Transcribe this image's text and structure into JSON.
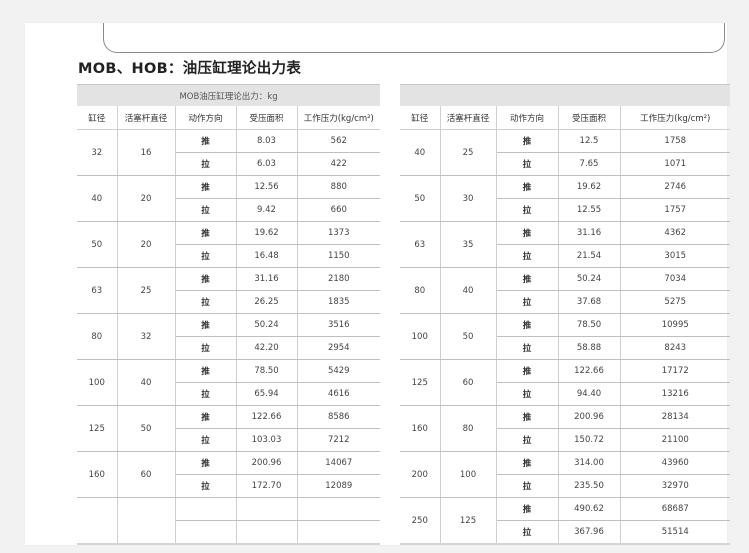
{
  "title": "MOB、HOB：油压缸理论出力表",
  "tables": [
    {
      "caption": "MOB油压缸理论出力：kg",
      "headers": [
        "缸径",
        "活塞杆直径",
        "动作方向",
        "受压面积",
        "工作压力(kg/cm²)"
      ],
      "groups": [
        {
          "bore": "32",
          "rod": "16",
          "rows": [
            [
              "推",
              "8.03",
              "562"
            ],
            [
              "拉",
              "6.03",
              "422"
            ]
          ]
        },
        {
          "bore": "40",
          "rod": "20",
          "rows": [
            [
              "推",
              "12.56",
              "880"
            ],
            [
              "拉",
              "9.42",
              "660"
            ]
          ]
        },
        {
          "bore": "50",
          "rod": "20",
          "rows": [
            [
              "推",
              "19.62",
              "1373"
            ],
            [
              "拉",
              "16.48",
              "1150"
            ]
          ]
        },
        {
          "bore": "63",
          "rod": "25",
          "rows": [
            [
              "推",
              "31.16",
              "2180"
            ],
            [
              "拉",
              "26.25",
              "1835"
            ]
          ]
        },
        {
          "bore": "80",
          "rod": "32",
          "rows": [
            [
              "推",
              "50.24",
              "3516"
            ],
            [
              "拉",
              "42.20",
              "2954"
            ]
          ]
        },
        {
          "bore": "100",
          "rod": "40",
          "rows": [
            [
              "推",
              "78.50",
              "5429"
            ],
            [
              "拉",
              "65.94",
              "4616"
            ]
          ]
        },
        {
          "bore": "125",
          "rod": "50",
          "rows": [
            [
              "推",
              "122.66",
              "8586"
            ],
            [
              "拉",
              "103.03",
              "7212"
            ]
          ]
        },
        {
          "bore": "160",
          "rod": "60",
          "rows": [
            [
              "推",
              "200.96",
              "14067"
            ],
            [
              "拉",
              "172.70",
              "12089"
            ]
          ]
        },
        {
          "bore": "",
          "rod": "",
          "rows": [
            [
              "",
              "",
              ""
            ],
            [
              "",
              "",
              ""
            ]
          ]
        }
      ]
    },
    {
      "caption": "",
      "headers": [
        "缸径",
        "活塞杆直径",
        "动作方向",
        "受压面积",
        "工作压力(kg/cm²)"
      ],
      "groups": [
        {
          "bore": "40",
          "rod": "25",
          "rows": [
            [
              "推",
              "12.5",
              "1758"
            ],
            [
              "拉",
              "7.65",
              "1071"
            ]
          ]
        },
        {
          "bore": "50",
          "rod": "30",
          "rows": [
            [
              "推",
              "19.62",
              "2746"
            ],
            [
              "拉",
              "12.55",
              "1757"
            ]
          ]
        },
        {
          "bore": "63",
          "rod": "35",
          "rows": [
            [
              "推",
              "31.16",
              "4362"
            ],
            [
              "拉",
              "21.54",
              "3015"
            ]
          ]
        },
        {
          "bore": "80",
          "rod": "40",
          "rows": [
            [
              "推",
              "50.24",
              "7034"
            ],
            [
              "拉",
              "37.68",
              "5275"
            ]
          ]
        },
        {
          "bore": "100",
          "rod": "50",
          "rows": [
            [
              "推",
              "78.50",
              "10995"
            ],
            [
              "拉",
              "58.88",
              "8243"
            ]
          ]
        },
        {
          "bore": "125",
          "rod": "60",
          "rows": [
            [
              "推",
              "122.66",
              "17172"
            ],
            [
              "拉",
              "94.40",
              "13216"
            ]
          ]
        },
        {
          "bore": "160",
          "rod": "80",
          "rows": [
            [
              "推",
              "200.96",
              "28134"
            ],
            [
              "拉",
              "150.72",
              "21100"
            ]
          ]
        },
        {
          "bore": "200",
          "rod": "100",
          "rows": [
            [
              "推",
              "314.00",
              "43960"
            ],
            [
              "拉",
              "235.50",
              "32970"
            ]
          ]
        },
        {
          "bore": "250",
          "rod": "125",
          "rows": [
            [
              "推",
              "490.62",
              "68687"
            ],
            [
              "拉",
              "367.96",
              "51514"
            ]
          ]
        }
      ]
    }
  ]
}
